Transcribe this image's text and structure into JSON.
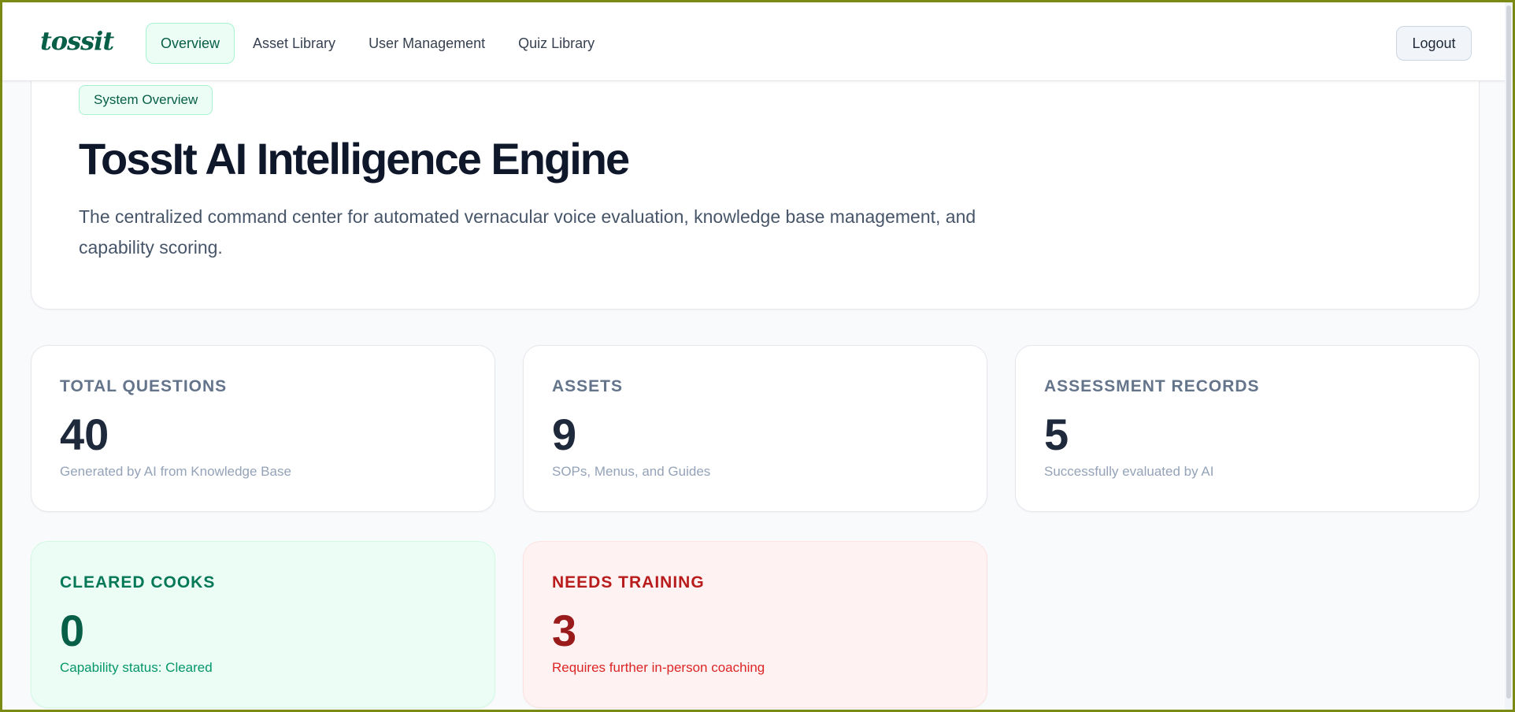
{
  "header": {
    "brand": "tossit",
    "nav": [
      {
        "label": "Overview",
        "active": true
      },
      {
        "label": "Asset Library",
        "active": false
      },
      {
        "label": "User Management",
        "active": false
      },
      {
        "label": "Quiz Library",
        "active": false
      }
    ],
    "logout_label": "Logout"
  },
  "hero": {
    "badge": "System Overview",
    "title": "TossIt AI Intelligence Engine",
    "description": "The centralized command center for automated vernacular voice evaluation, knowledge base management, and capability scoring."
  },
  "stats": [
    {
      "label": "TOTAL QUESTIONS",
      "value": "40",
      "note": "Generated by AI from Knowledge Base",
      "tone": "neutral"
    },
    {
      "label": "ASSETS",
      "value": "9",
      "note": "SOPs, Menus, and Guides",
      "tone": "neutral"
    },
    {
      "label": "ASSESSMENT RECORDS",
      "value": "5",
      "note": "Successfully evaluated by AI",
      "tone": "neutral"
    },
    {
      "label": "CLEARED COOKS",
      "value": "0",
      "note": "Capability status: Cleared",
      "tone": "green"
    },
    {
      "label": "NEEDS TRAINING",
      "value": "3",
      "note": "Requires further in-person coaching",
      "tone": "red"
    }
  ],
  "colors": {
    "brand": "#065f46",
    "accent_green_bg": "#ecfdf5",
    "accent_red_bg": "#fef2f2",
    "page_bg": "#f8fafc"
  }
}
